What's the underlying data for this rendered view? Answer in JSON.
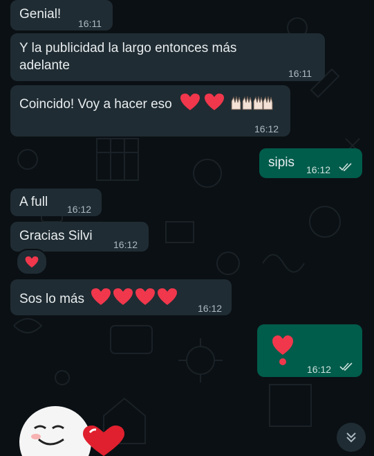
{
  "messages": [
    {
      "text": "Genial!",
      "time": "16:11"
    },
    {
      "line1": "Y la publicidad la largo entonces más",
      "line2": "adelante",
      "time": "16:11"
    },
    {
      "text": "Coincido! Voy a hacer eso",
      "time": "16:12"
    },
    {
      "text": "sipis",
      "time": "16:12"
    },
    {
      "text": "A full",
      "time": "16:12"
    },
    {
      "text": "Gracias Silvi",
      "time": "16:12"
    },
    {
      "text": "Sos lo más",
      "time": "16:12"
    },
    {
      "time": "16:12"
    }
  ],
  "icons": {
    "heart": "red-heart-icon",
    "hands": "raising-hands-icon",
    "exclamation": "heart-exclamation-icon",
    "read": "double-check-icon",
    "scroll": "chevron-double-down-icon"
  },
  "colors": {
    "background": "#0b1014",
    "incoming": "#1f2c33",
    "outgoing": "#005c4b",
    "heart": "#f0374c"
  }
}
